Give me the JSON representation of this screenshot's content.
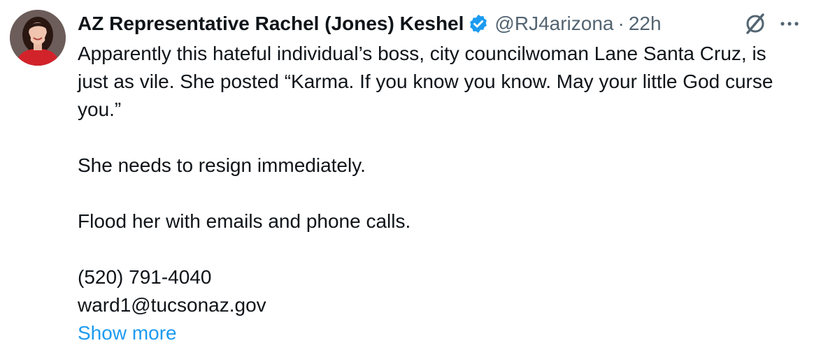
{
  "tweet": {
    "author_name": "AZ Representative Rachel (Jones) Keshel",
    "handle": "@RJ4arizona",
    "separator": "·",
    "time": "22h",
    "lines": [
      "Apparently this hateful individual’s boss, city councilwoman Lane Santa Cruz, is just as vile. She posted “Karma. If you know you know. May your little God curse you.”",
      "She needs to resign immediately.",
      "Flood her with emails and phone calls.",
      "(520) 791-4040",
      "ward1@tucsonaz.gov"
    ],
    "show_more": "Show more"
  },
  "icons": {
    "verified": "verified-badge-icon",
    "grok": "grok-icon",
    "more": "more-options-icon"
  },
  "colors": {
    "accent": "#1d9bf0",
    "secondary_text": "#536471",
    "primary_text": "#0f1419",
    "avatar_jacket": "#d2232a"
  }
}
